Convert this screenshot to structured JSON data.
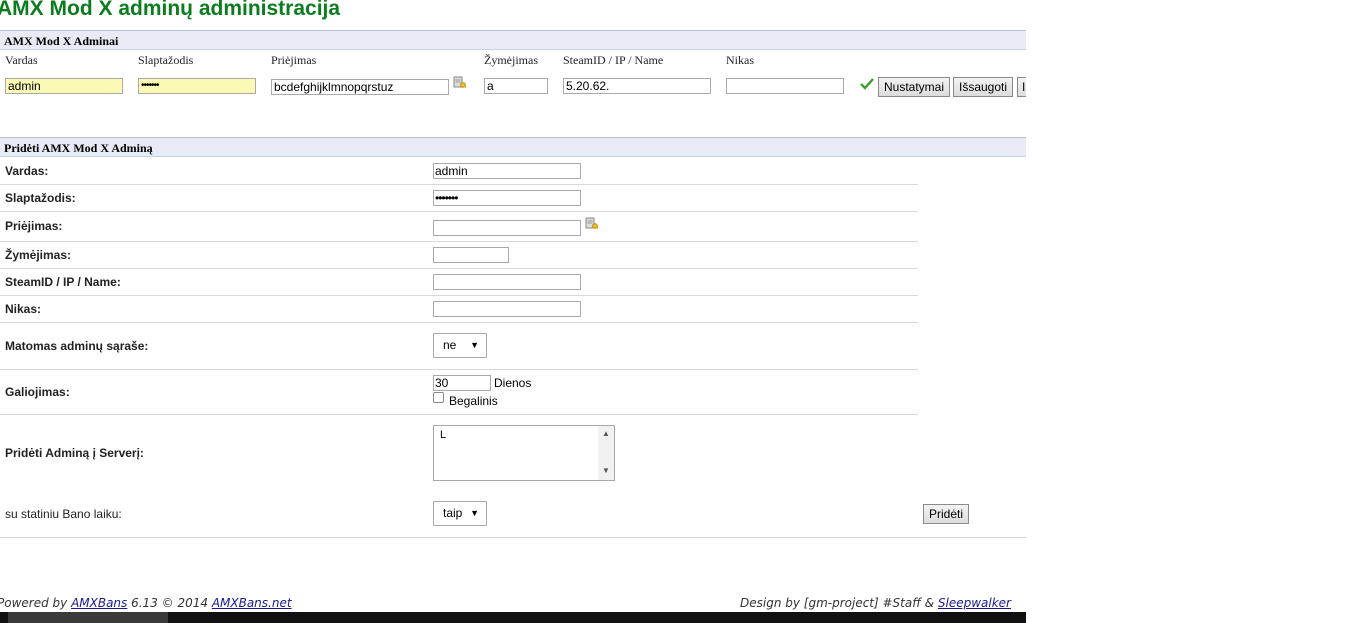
{
  "page": {
    "title": "AMX Mod X adminų administracija"
  },
  "admins": {
    "header": "AMX Mod X Adminai",
    "columns": [
      "Vardas",
      "Slaptažodis",
      "Priėjimas",
      "Žymėjimas",
      "SteamID / IP / Name",
      "Nikas"
    ],
    "row": {
      "vardas": "admin",
      "slaptazodis": "•••••••",
      "priejimas": "bcdefghijklmnopqrstuz",
      "zymejimas": "a",
      "steamid": "5.20.62.",
      "nikas": ""
    },
    "buttons": {
      "settings": "Nustatymai",
      "save": "Išsaugoti",
      "delete": "I"
    },
    "icons": {
      "access": "key-icon",
      "status": "check-icon"
    }
  },
  "add_admin": {
    "header": "Pridėti AMX Mod X Adminą",
    "labels": {
      "vardas": "Vardas:",
      "slaptazodis": "Slaptažodis:",
      "priejimas": "Priėjimas:",
      "zymejimas": "Žymėjimas:",
      "steamid": "SteamID / IP / Name:",
      "nikas": "Nikas:",
      "matomas": "Matomas adminų sąraše:",
      "galiojimas": "Galiojimas:",
      "serveris": "Pridėti Adminą į Serverį:",
      "bano": "su statiniu Bano laiku:"
    },
    "values": {
      "vardas": "admin",
      "slaptazodis": "•••••••",
      "priejimas": "",
      "zymejimas": "",
      "steamid": "",
      "nikas": "",
      "matomas": "ne",
      "galiojimas": "30",
      "galiojimas_unit": "Dienos",
      "begalinis": "Begalinis",
      "serveris_item": "L",
      "bano": "taip"
    },
    "button": "Pridėti"
  },
  "footer": {
    "powered_prefix": "Powered by ",
    "amxbans": "AMXBans",
    "version": " 6.13 © 2014 ",
    "site": "AMXBans.net",
    "design_prefix": "Design by [gm-project] #Staff & ",
    "author": "Sleepwalker"
  },
  "colors": {
    "title": "#0b7d1e",
    "header_bg": "#e8ebf5",
    "input_highlight": "#fafab6"
  }
}
